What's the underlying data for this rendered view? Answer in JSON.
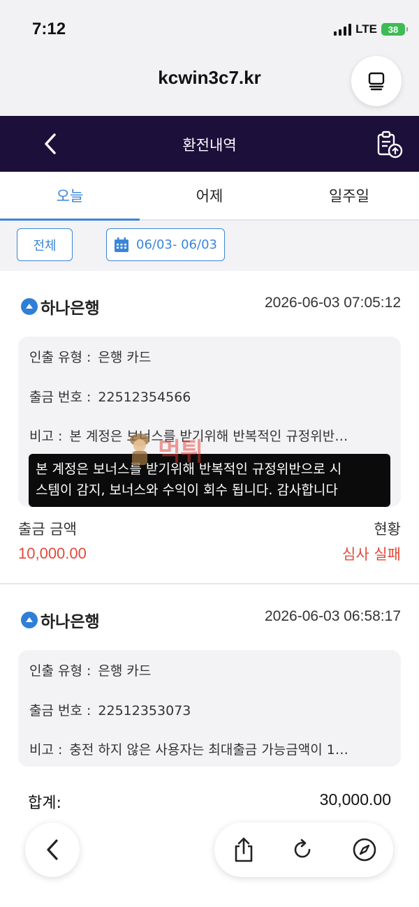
{
  "status_bar": {
    "time": "7:12",
    "network": "LTE",
    "battery": "38"
  },
  "browser": {
    "url": "kcwin3c7.kr"
  },
  "header": {
    "title": "환전내역"
  },
  "date_tabs": [
    {
      "label": "오늘",
      "active": true
    },
    {
      "label": "어제",
      "active": false
    },
    {
      "label": "일주일",
      "active": false
    }
  ],
  "filters": {
    "all_label": "전체",
    "date_range": "06/03- 06/03"
  },
  "records": [
    {
      "bank": "하나은행",
      "datetime": "2026-06-03 07:05:12",
      "type_label": "인출 유형 :",
      "type_value": "은행 카드",
      "number_label": "출금 번호 :",
      "number_value": "22512354566",
      "note_label": "비고 :",
      "note_value": "본 계정은 보너스를 받기위해 반복적인 규정위반…",
      "amount_label": "출금 금액",
      "amount_value": "10,000.00",
      "status_label": "현황",
      "status_value": "심사 실패"
    },
    {
      "bank": "하나은행",
      "datetime": "2026-06-03 06:58:17",
      "type_label": "인출 유형 :",
      "type_value": "은행 카드",
      "number_label": "출금 번호 :",
      "number_value": "22512353073",
      "note_label": "비고 :",
      "note_value": "충전 하지 않은 사용자는 최대출금 가능금액이 1…"
    }
  ],
  "tooltip": {
    "line1": "본 계정은 보너스를 받기위해 반복적인 규정위반으로 시",
    "line2": "스템이 감지, 보너스와 수익이 회수 됩니다. 감사합니다"
  },
  "watermark": {
    "text": "먹튀"
  },
  "total": {
    "label": "합계:",
    "value": "30,000.00"
  },
  "colors": {
    "header_bg": "#1c0f3a",
    "accent": "#3a86d8",
    "error": "#e24a3b"
  },
  "icons": [
    "signal-icon",
    "battery-icon",
    "tabs-icon",
    "back-icon",
    "clipboard-upload-icon",
    "calendar-icon",
    "bank-logo-icon",
    "share-icon",
    "reload-icon",
    "compass-icon"
  ]
}
